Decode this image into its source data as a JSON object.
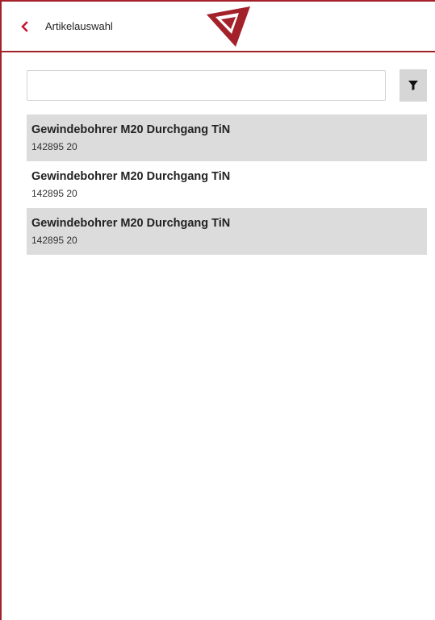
{
  "header": {
    "back_icon": "chevron-left-icon",
    "title": "Artikelauswahl",
    "logo": "red-triangle-logo"
  },
  "colors": {
    "accent": "#a3222a",
    "row_shaded": "#dcdcdc",
    "filter_button": "#d6d6d6"
  },
  "search": {
    "value": "",
    "placeholder": ""
  },
  "filter": {
    "icon": "filter-funnel-icon"
  },
  "items": [
    {
      "title": "Gewindebohrer M20 Durchgang TiN",
      "number": "142895 20"
    },
    {
      "title": "Gewindebohrer M20 Durchgang TiN",
      "number": "142895 20"
    },
    {
      "title": "Gewindebohrer M20 Durchgang TiN",
      "number": "142895 20"
    }
  ]
}
